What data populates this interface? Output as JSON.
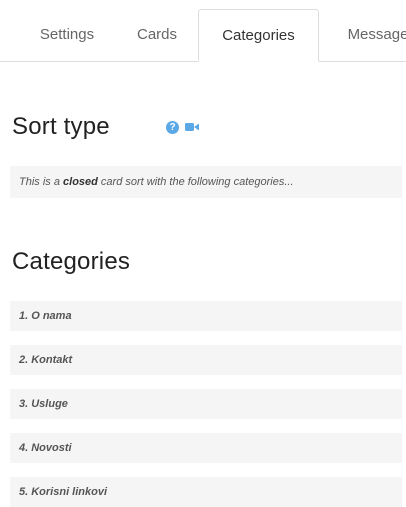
{
  "tabs": [
    {
      "label": "Settings"
    },
    {
      "label": "Cards"
    },
    {
      "label": "Categories"
    },
    {
      "label": "Message"
    }
  ],
  "active_tab": "Categories",
  "sort_type": {
    "heading": "Sort type",
    "intro_prefix": "This is a ",
    "intro_bold": "closed",
    "intro_suffix": " card sort with the following categories..."
  },
  "categories": {
    "heading": "Categories",
    "items": [
      {
        "label": "1. O nama"
      },
      {
        "label": "2. Kontakt"
      },
      {
        "label": "3. Usluge"
      },
      {
        "label": "4. Novosti"
      },
      {
        "label": "5. Korisni linkovi"
      }
    ]
  },
  "colors": {
    "icon_blue": "#5aa9e6",
    "row_bg": "#f5f5f5",
    "border": "#dddddd"
  },
  "icons": [
    "help-icon",
    "video-icon"
  ]
}
